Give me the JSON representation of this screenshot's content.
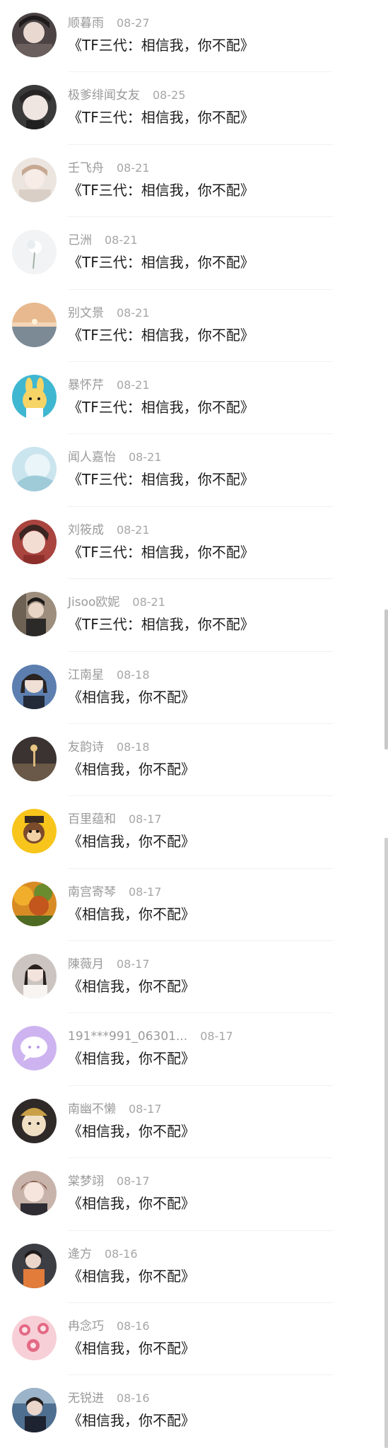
{
  "comments": [
    {
      "name": "顺暮雨",
      "time": "08-27",
      "text": "《TF三代：相信我，你不配》",
      "avatar": "portrait-dark"
    },
    {
      "name": "极爹绯闻女友",
      "time": "08-25",
      "text": "《TF三代：相信我，你不配》",
      "avatar": "portrait-boy"
    },
    {
      "name": "壬飞舟",
      "time": "08-21",
      "text": "《TF三代：相信我，你不配》",
      "avatar": "portrait-light"
    },
    {
      "name": "己洲",
      "time": "08-21",
      "text": "《TF三代：相信我，你不配》",
      "avatar": "flower-white"
    },
    {
      "name": "别文景",
      "time": "08-21",
      "text": "《TF三代：相信我，你不配》",
      "avatar": "sunset-sea"
    },
    {
      "name": "暴怀芹",
      "time": "08-21",
      "text": "《TF三代：相信我，你不配》",
      "avatar": "cartoon-bunny"
    },
    {
      "name": "闻人嘉怡",
      "time": "08-21",
      "text": "《TF三代：相信我，你不配》",
      "avatar": "blue-mist"
    },
    {
      "name": "刘筱成",
      "time": "08-21",
      "text": "《TF三代：相信我，你不配》",
      "avatar": "portrait-girl"
    },
    {
      "name": "Jisoo欧妮",
      "time": "08-21",
      "text": "《TF三代：相信我，你不配》",
      "avatar": "portrait-street"
    },
    {
      "name": "江南星",
      "time": "08-18",
      "text": "《相信我，你不配》",
      "avatar": "portrait-blue"
    },
    {
      "name": "友韵诗",
      "time": "08-18",
      "text": "《相信我，你不配》",
      "avatar": "dark-table"
    },
    {
      "name": "百里蕴和",
      "time": "08-17",
      "text": "《相信我，你不配》",
      "avatar": "cartoon-monkey"
    },
    {
      "name": "南宫寄琴",
      "time": "08-17",
      "text": "《相信我，你不配》",
      "avatar": "autumn-trees"
    },
    {
      "name": "陳薇月",
      "time": "08-17",
      "text": "《相信我，你不配》",
      "avatar": "portrait-white"
    },
    {
      "name": "191***991_06301...",
      "time": "08-17",
      "text": "《相信我，你不配》",
      "avatar": "default-chat"
    },
    {
      "name": "南幽不懒",
      "time": "08-17",
      "text": "《相信我，你不配》",
      "avatar": "cat-hat"
    },
    {
      "name": "棠梦翊",
      "time": "08-17",
      "text": "《相信我，你不配》",
      "avatar": "portrait-bangs"
    },
    {
      "name": "逄方",
      "time": "08-16",
      "text": "《相信我，你不配》",
      "avatar": "portrait-orange"
    },
    {
      "name": "冉念巧",
      "time": "08-16",
      "text": "《相信我，你不配》",
      "avatar": "pink-dolls"
    },
    {
      "name": "无锐进",
      "time": "08-16",
      "text": "《相信我，你不配》",
      "avatar": "portrait-city"
    }
  ]
}
